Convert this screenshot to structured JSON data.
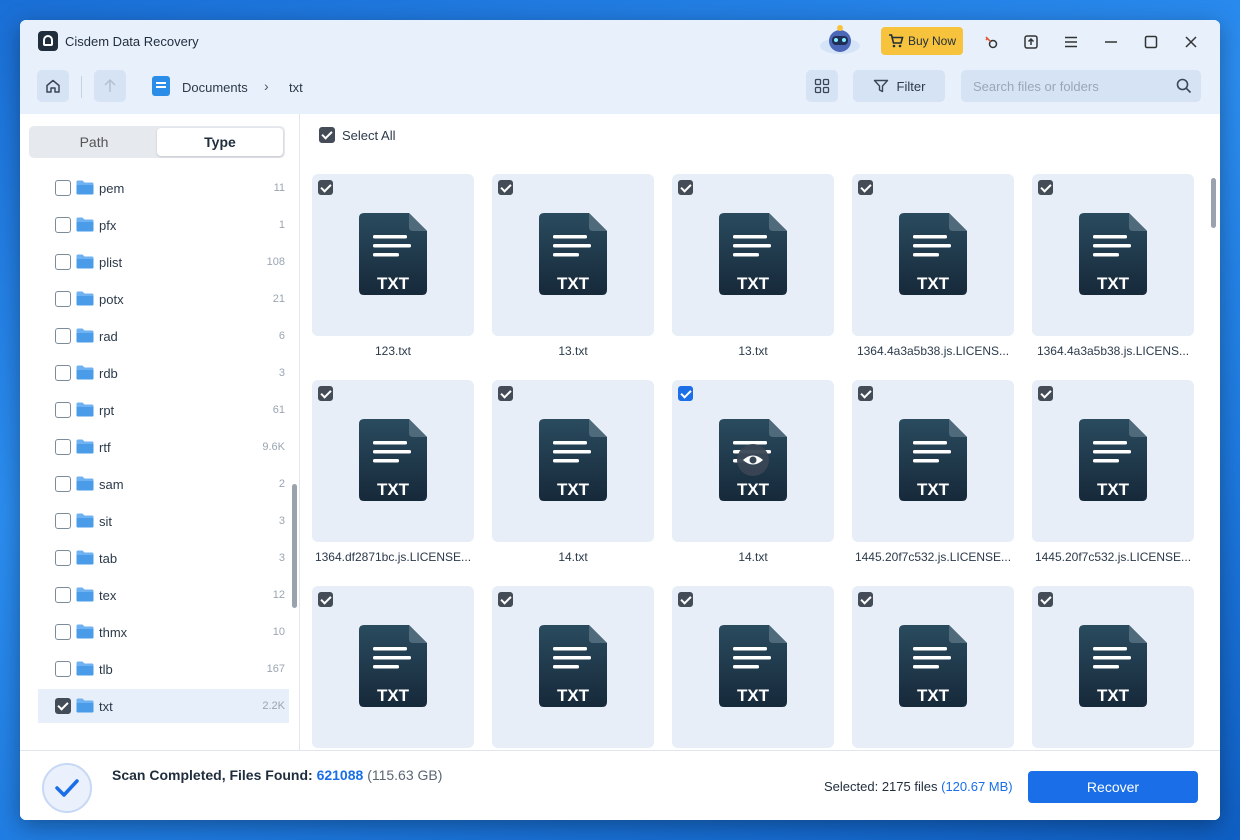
{
  "app": {
    "title": "Cisdem Data Recovery",
    "buy_label": "Buy Now"
  },
  "nav": {
    "breadcrumb": [
      "Documents",
      "txt"
    ],
    "separator": "›",
    "filter_label": "Filter",
    "search_placeholder": "Search files or folders"
  },
  "sidebar": {
    "tabs": [
      "Path",
      "Type"
    ],
    "active_tab": "Type",
    "types": [
      {
        "name": "pem",
        "count": "11",
        "checked": false
      },
      {
        "name": "pfx",
        "count": "1",
        "checked": false
      },
      {
        "name": "plist",
        "count": "108",
        "checked": false
      },
      {
        "name": "potx",
        "count": "21",
        "checked": false
      },
      {
        "name": "rad",
        "count": "6",
        "checked": false
      },
      {
        "name": "rdb",
        "count": "3",
        "checked": false
      },
      {
        "name": "rpt",
        "count": "61",
        "checked": false
      },
      {
        "name": "rtf",
        "count": "9.6K",
        "checked": false
      },
      {
        "name": "sam",
        "count": "2",
        "checked": false
      },
      {
        "name": "sit",
        "count": "3",
        "checked": false
      },
      {
        "name": "tab",
        "count": "3",
        "checked": false
      },
      {
        "name": "tex",
        "count": "12",
        "checked": false
      },
      {
        "name": "thmx",
        "count": "10",
        "checked": false
      },
      {
        "name": "tlb",
        "count": "167",
        "checked": false
      },
      {
        "name": "txt",
        "count": "2.2K",
        "checked": true
      }
    ]
  },
  "main": {
    "select_all_label": "Select All",
    "file_badge": "TXT",
    "files": [
      {
        "name": "123.txt",
        "checked": true,
        "hover": false
      },
      {
        "name": "13.txt",
        "checked": true,
        "hover": false
      },
      {
        "name": "13.txt",
        "checked": true,
        "hover": false
      },
      {
        "name": "1364.4a3a5b38.js.LICENS...",
        "checked": true,
        "hover": false
      },
      {
        "name": "1364.4a3a5b38.js.LICENS...",
        "checked": true,
        "hover": false
      },
      {
        "name": "1364.df2871bc.js.LICENSE...",
        "checked": true,
        "hover": false
      },
      {
        "name": "14.txt",
        "checked": true,
        "hover": false
      },
      {
        "name": "14.txt",
        "checked": true,
        "hover": true
      },
      {
        "name": "1445.20f7c532.js.LICENSE...",
        "checked": true,
        "hover": false
      },
      {
        "name": "1445.20f7c532.js.LICENSE...",
        "checked": true,
        "hover": false
      },
      {
        "name": "",
        "checked": true,
        "hover": false
      },
      {
        "name": "",
        "checked": true,
        "hover": false
      },
      {
        "name": "",
        "checked": true,
        "hover": false
      },
      {
        "name": "",
        "checked": true,
        "hover": false
      },
      {
        "name": "",
        "checked": true,
        "hover": false
      }
    ]
  },
  "footer": {
    "scan_label": "Scan Completed, Files Found:",
    "files_found": "621088",
    "total_size": "(115.63 GB)",
    "selected_label": "Selected:",
    "selected_files": "2175 files",
    "selected_size": "(120.67 MB)",
    "recover_label": "Recover"
  },
  "colors": {
    "accent": "#1a6fe8",
    "buy": "#f7c23c",
    "file_icon": "#1f3a4a"
  }
}
